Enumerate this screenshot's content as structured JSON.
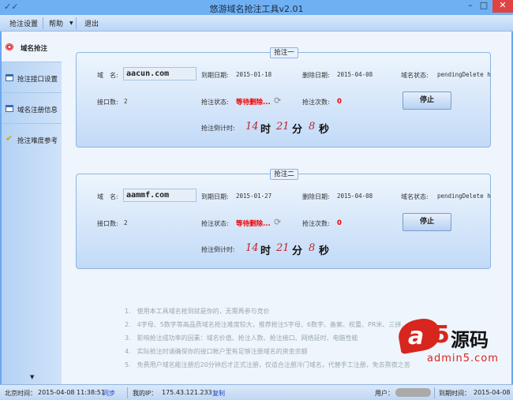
{
  "window": {
    "title": "悠游域名抢注工具v2.01"
  },
  "toolbar": {
    "items": [
      "抢注设置",
      "帮助",
      "退出"
    ]
  },
  "sidebar": {
    "items": [
      {
        "label": "域名抢注",
        "icon": "target-icon"
      },
      {
        "label": "抢注接口设置",
        "icon": "window-icon"
      },
      {
        "label": "域名注册信息",
        "icon": "window-icon"
      },
      {
        "label": "抢注难度参考",
        "icon": "checkmark-icon"
      }
    ]
  },
  "panels": [
    {
      "title": "抢注一",
      "domain_label": "域　名:",
      "domain": "aacun.com",
      "expire_label": "到期日期:",
      "expire": "2015-01-18",
      "delete_label": "删除日期:",
      "delete": "2015-04-08",
      "status_label": "域名状态:",
      "status": "pendingDelete htt",
      "iface_label": "接口数:",
      "iface": "2",
      "grab_label": "抢注状态:",
      "grab": "等待删除...",
      "count_label": "抢注次数:",
      "count": "0",
      "button": "停止",
      "cd_label": "抢注倒计时:",
      "hours": "14",
      "h": "时",
      "minutes": "21",
      "m": "分",
      "seconds": "8",
      "s": "秒"
    },
    {
      "title": "抢注二",
      "domain_label": "域　名:",
      "domain": "aammf.com",
      "expire_label": "到期日期:",
      "expire": "2015-01-27",
      "delete_label": "删除日期:",
      "delete": "2015-04-08",
      "status_label": "域名状态:",
      "status": "pendingDelete htt",
      "iface_label": "接口数:",
      "iface": "2",
      "grab_label": "抢注状态:",
      "grab": "等待删除...",
      "count_label": "抢注次数:",
      "count": "0",
      "button": "停止",
      "cd_label": "抢注倒计时:",
      "hours": "14",
      "h": "时",
      "minutes": "21",
      "m": "分",
      "seconds": "8",
      "s": "秒"
    }
  ],
  "tips": [
    "1.　使用本工具域名抢到就是你的，无需再参与竞价",
    "2.　4字母、5数字等高品质域名抢注难度较大，推荐抢注5字母、6数字、备案、权重、PR米、三拼...",
    "3.　影响抢注成功率的因素：域名价值、抢注人数、抢注接口、网络延时、电脑性能",
    "4.　实际抢注时请确保你的接口帐户里有足够注册域名的资金余额",
    "5.　免费用户域名能注册后20分钟后才正式注册，仅适合注册冷门域名，代替手工注册，免去熬夜之苦"
  ],
  "watermark": {
    "brand": "a5源码",
    "url": "admin5.com",
    "color": "#d7261e"
  },
  "status": {
    "time_label": "北京时间：",
    "time": "2015-04-08 11:38:51",
    "sync": "同步",
    "ip_label": "我的IP：",
    "ip": "175.43.121.233",
    "copy": "复制",
    "user_label": "用户：",
    "expire_label": "到期时间：",
    "expire": "2015-04-08"
  }
}
